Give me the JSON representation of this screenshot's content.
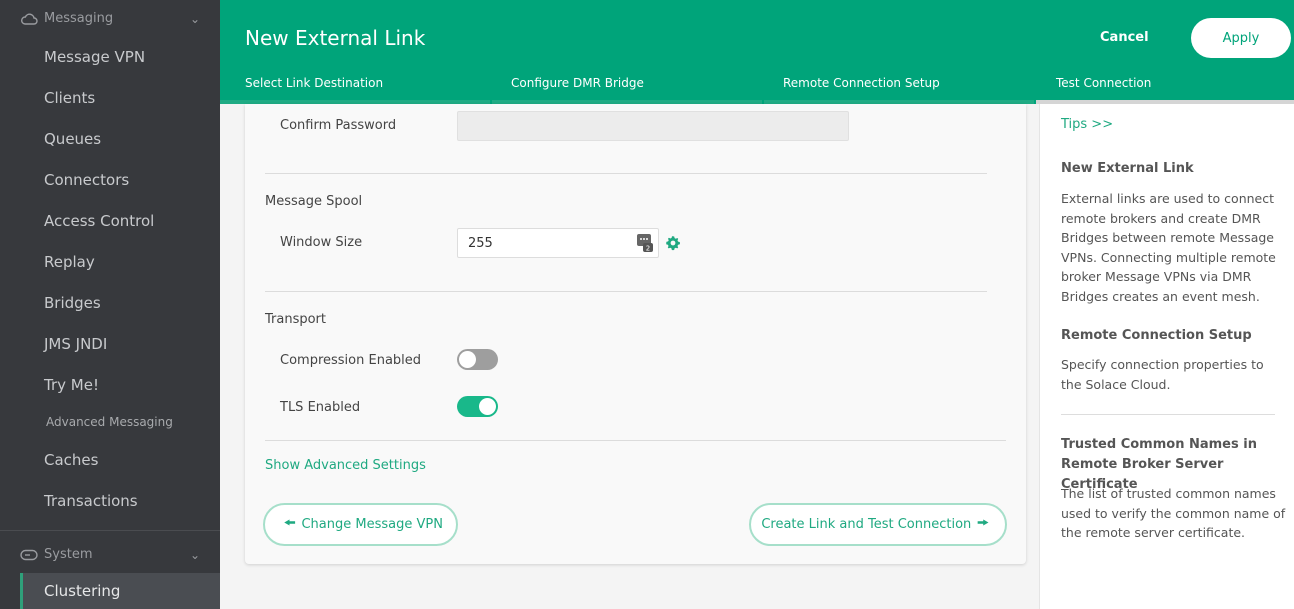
{
  "sidebar": {
    "messaging_section": "Messaging",
    "items": [
      "Message VPN",
      "Clients",
      "Queues",
      "Connectors",
      "Access Control",
      "Replay",
      "Bridges",
      "JMS JNDI",
      "Try Me!"
    ],
    "advanced_label": "Advanced Messaging",
    "advanced_items": [
      "Caches",
      "Transactions"
    ],
    "system_section": "System",
    "active_item": "Clustering"
  },
  "header": {
    "title": "New External Link",
    "cancel_label": "Cancel",
    "apply_label": "Apply",
    "steps": [
      "Select Link Destination",
      "Configure DMR Bridge",
      "Remote Connection Setup",
      "Test Connection"
    ],
    "accent": "#00a47a"
  },
  "form": {
    "confirm_password_label": "Confirm Password",
    "confirm_password_value": "",
    "message_spool_title": "Message Spool",
    "window_size_label": "Window Size",
    "window_size_value": "255",
    "transport_title": "Transport",
    "compression_label": "Compression Enabled",
    "compression_enabled": false,
    "tls_label": "TLS Enabled",
    "tls_enabled": true,
    "show_advanced": "Show Advanced Settings",
    "back_button": "Change Message VPN",
    "next_button": "Create Link and Test Connection"
  },
  "tips": {
    "link": "Tips >>",
    "h1": "New External Link",
    "p1": "External links are used to connect remote brokers and create DMR Bridges between remote Message VPNs. Connecting multiple remote broker Message VPNs via DMR Bridges creates an event mesh.",
    "h2": "Remote Connection Setup",
    "p2": "Specify connection properties to the Solace Cloud.",
    "h3": "Trusted Common Names in Remote Broker Server Certificate",
    "p3": "The list of trusted common names used to verify the common name of the remote server certificate."
  }
}
